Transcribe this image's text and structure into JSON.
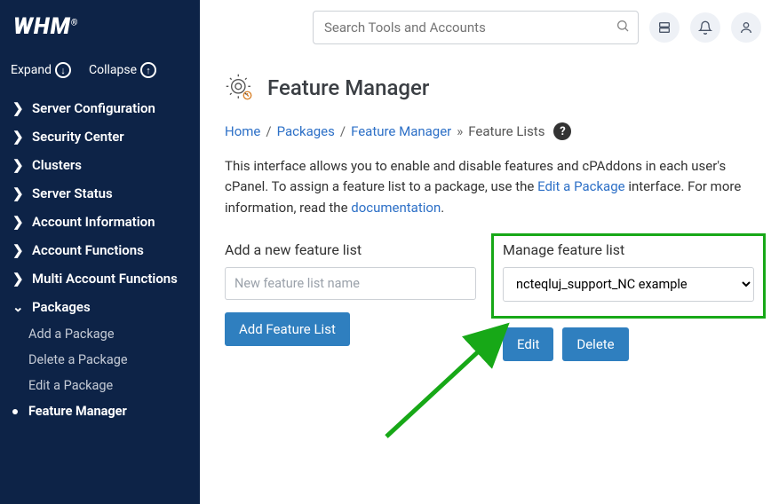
{
  "logo": "WHM",
  "expand": "Expand",
  "collapse": "Collapse",
  "nav": {
    "items": [
      "Server Configuration",
      "Security Center",
      "Clusters",
      "Server Status",
      "Account Information",
      "Account Functions",
      "Multi Account Functions",
      "Packages"
    ],
    "subs": [
      "Add a Package",
      "Delete a Package",
      "Edit a Package",
      "Feature Manager"
    ]
  },
  "search": {
    "placeholder": "Search Tools and Accounts"
  },
  "page": {
    "title": "Feature Manager"
  },
  "breadcrumb": {
    "home": "Home",
    "packages": "Packages",
    "feature_manager": "Feature Manager",
    "current": "Feature Lists"
  },
  "desc": {
    "text1": "This interface allows you to enable and disable features and cPAddons in each user's cPanel. To assign a feature list to a package, use the ",
    "link1": "Edit a Package",
    "text2": " interface. For more information, read the ",
    "link2": "documentation",
    "text3": "."
  },
  "form": {
    "add_label": "Add a new feature list",
    "add_placeholder": "New feature list name",
    "add_btn": "Add Feature List",
    "manage_label": "Manage feature list",
    "manage_value": "ncteqluj_support_NC example",
    "edit_btn": "Edit",
    "delete_btn": "Delete"
  }
}
